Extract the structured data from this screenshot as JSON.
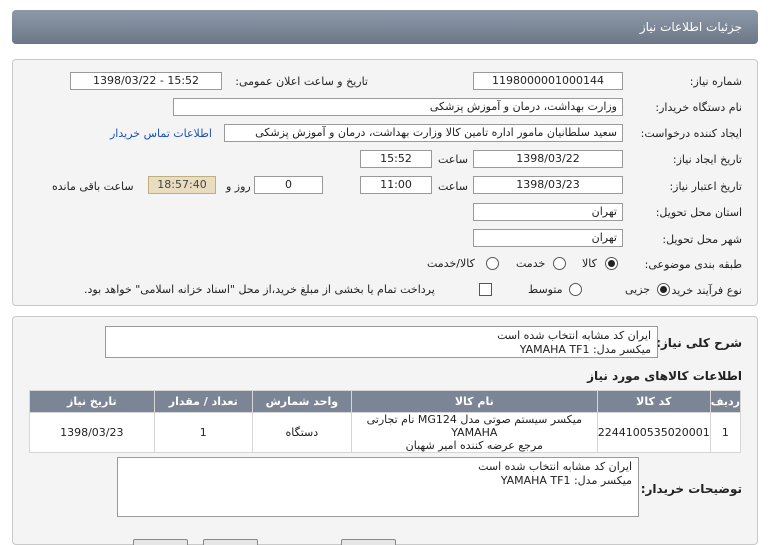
{
  "header": {
    "title": "جزئیات اطلاعات نیاز"
  },
  "form": {
    "need_number_label": "شماره نیاز:",
    "need_number": "1198000001000144",
    "announce_label": "تاریخ و ساعت اعلان عمومی:",
    "announce_value": "1398/03/22 - 15:52",
    "buyer_org_label": "نام دستگاه خریدار:",
    "buyer_org": "وزارت بهداشت، درمان و آموزش پزشکی",
    "requester_label": "ایجاد کننده درخواست:",
    "requester": "سعید سلطانیان مامور اداره تامین کالا وزارت بهداشت، درمان و آموزش پزشکی",
    "contact_link": "اطلاعات تماس خریدار",
    "created_label": "تاریخ ایجاد نیاز:",
    "created_date": "1398/03/22",
    "time_label": "ساعت",
    "created_time": "15:52",
    "validity_label": "تاریخ اعتبار نیاز:",
    "validity_date": "1398/03/23",
    "validity_time": "11:00",
    "days_value": "0",
    "days_label": "روز و",
    "remaining_time": "18:57:40",
    "remaining_label": "ساعت باقی مانده",
    "province_label": "استان محل تحویل:",
    "province": "تهران",
    "city_label": "شهر محل تحویل:",
    "city": "تهران",
    "category_label": "طبقه بندی موضوعی:",
    "category_options": [
      "کالا",
      "خدمت",
      "کالا/خدمت"
    ],
    "category_selected": "کالا",
    "process_label": "نوع فرآیند خرید :",
    "process_options": [
      "جزیی",
      "متوسط"
    ],
    "process_selected": "جزیی",
    "payment_note": "پرداخت تمام یا بخشی از مبلغ خرید،از محل \"اسناد خزانه اسلامی\" خواهد بود."
  },
  "summary": {
    "label": "شرح کلی نیاز:",
    "line1": "ایران کد مشابه انتخاب شده است",
    "line2": "میکسر مدل: YAMAHA TF1"
  },
  "items_section": {
    "title": "اطلاعات کالاهای مورد نیاز",
    "headers": [
      "ردیف",
      "کد کالا",
      "نام کالا",
      "واحد شمارش",
      "تعداد / مقدار",
      "تاریخ نیاز"
    ],
    "rows": [
      {
        "row": "1",
        "code": "2244100535020001",
        "name_line1": "میکسر سیستم صوتی مدل MG124 نام تجارتی YAMAHA",
        "name_line2": "مرجع عرضه کننده امیر شهبان",
        "unit": "دستگاه",
        "qty": "1",
        "date": "1398/03/23"
      }
    ]
  },
  "buyer_notes": {
    "label": "توضیحات خریدار:",
    "line1": "ایران کد مشابه انتخاب شده است",
    "line2": "میکسر مدل: YAMAHA TF1"
  }
}
